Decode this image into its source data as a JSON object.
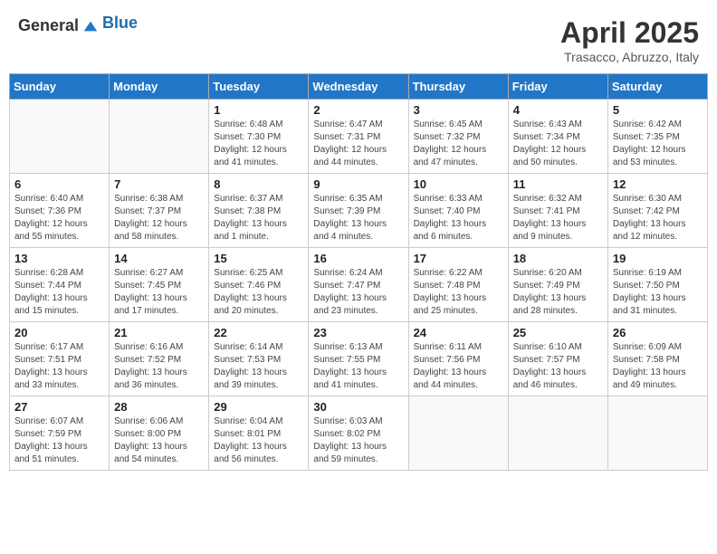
{
  "header": {
    "logo_general": "General",
    "logo_blue": "Blue",
    "month_title": "April 2025",
    "location": "Trasacco, Abruzzo, Italy"
  },
  "days_of_week": [
    "Sunday",
    "Monday",
    "Tuesday",
    "Wednesday",
    "Thursday",
    "Friday",
    "Saturday"
  ],
  "weeks": [
    [
      {
        "day": "",
        "sunrise": "",
        "sunset": "",
        "daylight": ""
      },
      {
        "day": "",
        "sunrise": "",
        "sunset": "",
        "daylight": ""
      },
      {
        "day": "1",
        "sunrise": "Sunrise: 6:48 AM",
        "sunset": "Sunset: 7:30 PM",
        "daylight": "Daylight: 12 hours and 41 minutes."
      },
      {
        "day": "2",
        "sunrise": "Sunrise: 6:47 AM",
        "sunset": "Sunset: 7:31 PM",
        "daylight": "Daylight: 12 hours and 44 minutes."
      },
      {
        "day": "3",
        "sunrise": "Sunrise: 6:45 AM",
        "sunset": "Sunset: 7:32 PM",
        "daylight": "Daylight: 12 hours and 47 minutes."
      },
      {
        "day": "4",
        "sunrise": "Sunrise: 6:43 AM",
        "sunset": "Sunset: 7:34 PM",
        "daylight": "Daylight: 12 hours and 50 minutes."
      },
      {
        "day": "5",
        "sunrise": "Sunrise: 6:42 AM",
        "sunset": "Sunset: 7:35 PM",
        "daylight": "Daylight: 12 hours and 53 minutes."
      }
    ],
    [
      {
        "day": "6",
        "sunrise": "Sunrise: 6:40 AM",
        "sunset": "Sunset: 7:36 PM",
        "daylight": "Daylight: 12 hours and 55 minutes."
      },
      {
        "day": "7",
        "sunrise": "Sunrise: 6:38 AM",
        "sunset": "Sunset: 7:37 PM",
        "daylight": "Daylight: 12 hours and 58 minutes."
      },
      {
        "day": "8",
        "sunrise": "Sunrise: 6:37 AM",
        "sunset": "Sunset: 7:38 PM",
        "daylight": "Daylight: 13 hours and 1 minute."
      },
      {
        "day": "9",
        "sunrise": "Sunrise: 6:35 AM",
        "sunset": "Sunset: 7:39 PM",
        "daylight": "Daylight: 13 hours and 4 minutes."
      },
      {
        "day": "10",
        "sunrise": "Sunrise: 6:33 AM",
        "sunset": "Sunset: 7:40 PM",
        "daylight": "Daylight: 13 hours and 6 minutes."
      },
      {
        "day": "11",
        "sunrise": "Sunrise: 6:32 AM",
        "sunset": "Sunset: 7:41 PM",
        "daylight": "Daylight: 13 hours and 9 minutes."
      },
      {
        "day": "12",
        "sunrise": "Sunrise: 6:30 AM",
        "sunset": "Sunset: 7:42 PM",
        "daylight": "Daylight: 13 hours and 12 minutes."
      }
    ],
    [
      {
        "day": "13",
        "sunrise": "Sunrise: 6:28 AM",
        "sunset": "Sunset: 7:44 PM",
        "daylight": "Daylight: 13 hours and 15 minutes."
      },
      {
        "day": "14",
        "sunrise": "Sunrise: 6:27 AM",
        "sunset": "Sunset: 7:45 PM",
        "daylight": "Daylight: 13 hours and 17 minutes."
      },
      {
        "day": "15",
        "sunrise": "Sunrise: 6:25 AM",
        "sunset": "Sunset: 7:46 PM",
        "daylight": "Daylight: 13 hours and 20 minutes."
      },
      {
        "day": "16",
        "sunrise": "Sunrise: 6:24 AM",
        "sunset": "Sunset: 7:47 PM",
        "daylight": "Daylight: 13 hours and 23 minutes."
      },
      {
        "day": "17",
        "sunrise": "Sunrise: 6:22 AM",
        "sunset": "Sunset: 7:48 PM",
        "daylight": "Daylight: 13 hours and 25 minutes."
      },
      {
        "day": "18",
        "sunrise": "Sunrise: 6:20 AM",
        "sunset": "Sunset: 7:49 PM",
        "daylight": "Daylight: 13 hours and 28 minutes."
      },
      {
        "day": "19",
        "sunrise": "Sunrise: 6:19 AM",
        "sunset": "Sunset: 7:50 PM",
        "daylight": "Daylight: 13 hours and 31 minutes."
      }
    ],
    [
      {
        "day": "20",
        "sunrise": "Sunrise: 6:17 AM",
        "sunset": "Sunset: 7:51 PM",
        "daylight": "Daylight: 13 hours and 33 minutes."
      },
      {
        "day": "21",
        "sunrise": "Sunrise: 6:16 AM",
        "sunset": "Sunset: 7:52 PM",
        "daylight": "Daylight: 13 hours and 36 minutes."
      },
      {
        "day": "22",
        "sunrise": "Sunrise: 6:14 AM",
        "sunset": "Sunset: 7:53 PM",
        "daylight": "Daylight: 13 hours and 39 minutes."
      },
      {
        "day": "23",
        "sunrise": "Sunrise: 6:13 AM",
        "sunset": "Sunset: 7:55 PM",
        "daylight": "Daylight: 13 hours and 41 minutes."
      },
      {
        "day": "24",
        "sunrise": "Sunrise: 6:11 AM",
        "sunset": "Sunset: 7:56 PM",
        "daylight": "Daylight: 13 hours and 44 minutes."
      },
      {
        "day": "25",
        "sunrise": "Sunrise: 6:10 AM",
        "sunset": "Sunset: 7:57 PM",
        "daylight": "Daylight: 13 hours and 46 minutes."
      },
      {
        "day": "26",
        "sunrise": "Sunrise: 6:09 AM",
        "sunset": "Sunset: 7:58 PM",
        "daylight": "Daylight: 13 hours and 49 minutes."
      }
    ],
    [
      {
        "day": "27",
        "sunrise": "Sunrise: 6:07 AM",
        "sunset": "Sunset: 7:59 PM",
        "daylight": "Daylight: 13 hours and 51 minutes."
      },
      {
        "day": "28",
        "sunrise": "Sunrise: 6:06 AM",
        "sunset": "Sunset: 8:00 PM",
        "daylight": "Daylight: 13 hours and 54 minutes."
      },
      {
        "day": "29",
        "sunrise": "Sunrise: 6:04 AM",
        "sunset": "Sunset: 8:01 PM",
        "daylight": "Daylight: 13 hours and 56 minutes."
      },
      {
        "day": "30",
        "sunrise": "Sunrise: 6:03 AM",
        "sunset": "Sunset: 8:02 PM",
        "daylight": "Daylight: 13 hours and 59 minutes."
      },
      {
        "day": "",
        "sunrise": "",
        "sunset": "",
        "daylight": ""
      },
      {
        "day": "",
        "sunrise": "",
        "sunset": "",
        "daylight": ""
      },
      {
        "day": "",
        "sunrise": "",
        "sunset": "",
        "daylight": ""
      }
    ]
  ]
}
